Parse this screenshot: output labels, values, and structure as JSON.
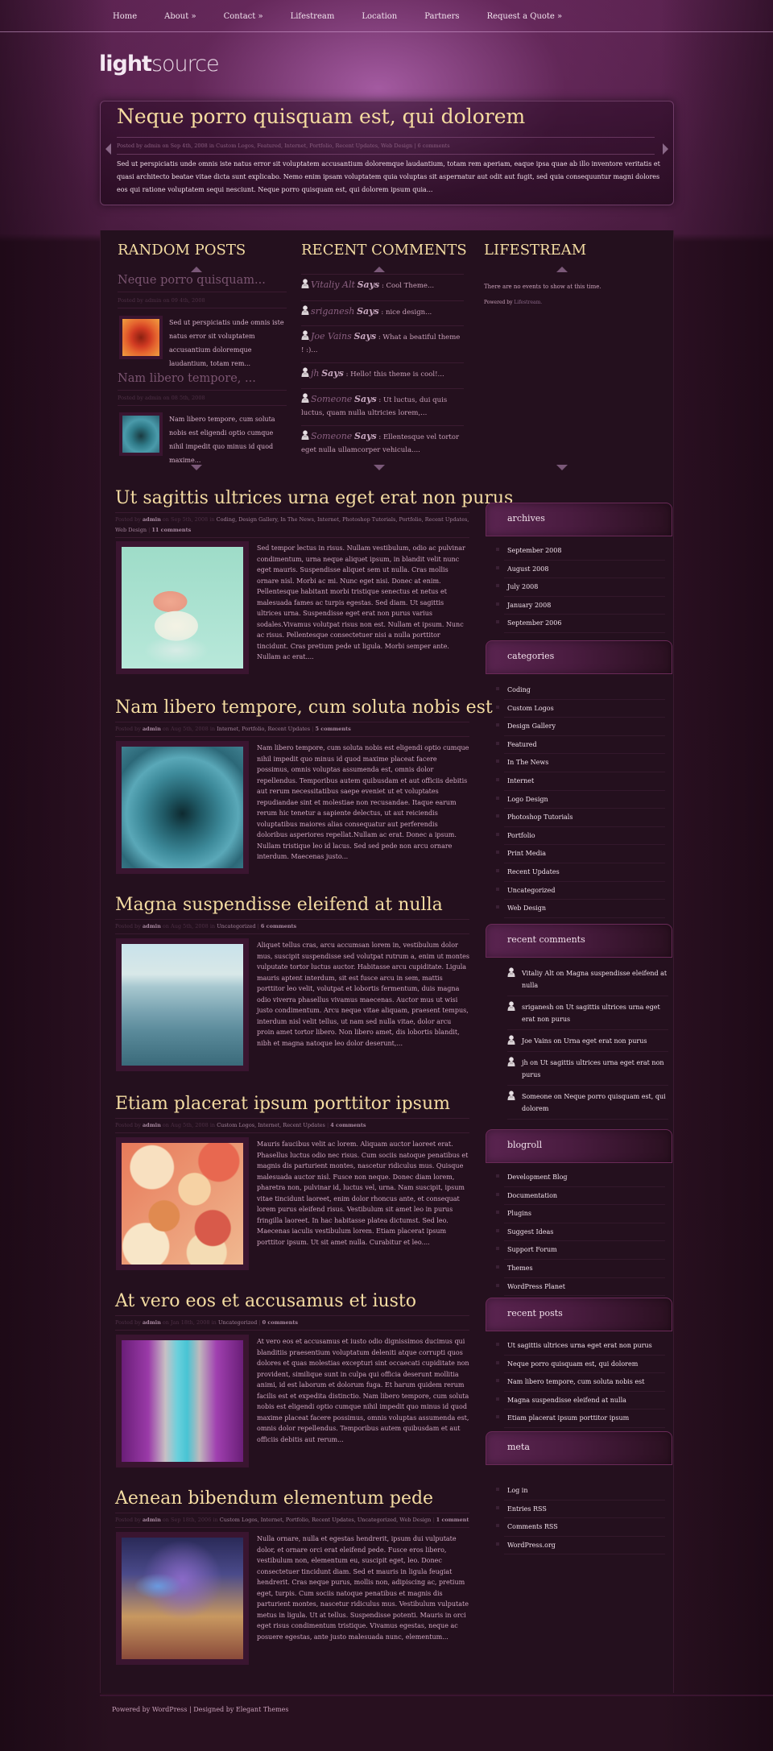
{
  "nav": {
    "items": [
      "Home",
      "About »",
      "Contact »",
      "Lifestream",
      "Location",
      "Partners",
      "Request a Quote »"
    ]
  },
  "logo": {
    "bold": "light",
    "light": "source"
  },
  "featured": {
    "title": "Neque porro quisquam est, qui dolorem",
    "meta": "Posted by admin on Sep 4th, 2008 in Custom Logos, Featured, Internet, Portfolio, Recent Updates, Web Design | 6 comments",
    "excerpt": "Sed ut perspiciatis unde omnis iste natus error sit voluptatem accusantium doloremque laudantium, totam rem aperiam, eaque ipsa quae ab illo inventore veritatis et quasi architecto beatae vitae dicta sunt explicabo. Nemo enim ipsam voluptatem quia voluptas sit aspernatur aut odit aut fugit, sed quia consequuntur magni dolores eos qui ratione voluptatem sequi nesciunt. Neque porro quisquam est, qui dolorem ipsum quia..."
  },
  "random_posts": {
    "title": "RANDOM POSTS",
    "items": [
      {
        "title": "Neque porro quisquam...",
        "meta": "Posted by admin on 09 4th, 2008",
        "excerpt": "Sed ut perspiciatis unde omnis iste natus error sit voluptatem accusantium doloremque laudantium, totam rem...",
        "image": "red-dahlia-flower"
      },
      {
        "title": "Nam libero tempore, ...",
        "meta": "Posted by admin on 08 5th, 2008",
        "excerpt": "Nam libero tempore, cum soluta nobis est eligendi optio cumque nihil impedit quo minus id quod maxime...",
        "image": "blue-succulent"
      }
    ]
  },
  "recent_comments_top": {
    "title": "RECENT COMMENTS",
    "says": "Says",
    "items": [
      {
        "name": "Vitaliy Alt",
        "text": ": Cool Theme..."
      },
      {
        "name": "sriganesh",
        "text": ": nice design..."
      },
      {
        "name": "Joe Vains",
        "text": ": What a beatiful theme ! :)..."
      },
      {
        "name": "jh",
        "text": ": Hello! this theme is cool!..."
      },
      {
        "name": "Someone",
        "text": ": Ut luctus, dui quis luctus, quam nulla ultricies lorem,..."
      },
      {
        "name": "Someone",
        "text": ": Ellentesque vel tortor eget nulla ullamcorper vehicula...."
      }
    ]
  },
  "lifestream": {
    "title": "LIFESTREAM",
    "empty": "There are no events to show at this time.",
    "powered_prefix": "Powered by",
    "powered_link": "Lifestream."
  },
  "posts": [
    {
      "title": "Ut sagittis ultrices urna eget erat non purus",
      "posted_by": "Posted by",
      "author": "admin",
      "date": "on Sep 5th, 2008 in",
      "categories": "Coding, Design Gallery, In The News, Internet, Photoshop Tutorials, Portfolio, Recent Updates, Web Design",
      "comments": "11 comments",
      "image": "teacup-macarons",
      "excerpt": "Sed tempor lectus in risus. Nullam vestibulum, odio ac pulvinar condimentum, urna neque aliquet ipsum, in blandit velit nunc eget mauris. Suspendisse aliquet sem ut nulla. Cras mollis ornare nisl. Morbi ac mi. Nunc eget nisi. Donec at enim. Pellentesque habitant morbi tristique senectus et netus et malesuada fames ac turpis egestas. Sed diam. Ut sagittis ultrices urna. Suspendisse eget erat non purus varius sodales.Vivamus volutpat risus non est. Nullam et ipsum. Nunc ac risus. Pellentesque consectetuer nisi a nulla porttitor tincidunt. Cras pretium pede ut ligula. Morbi semper ante. Nullam ac erat...."
    },
    {
      "title": "Nam libero tempore, cum soluta nobis est",
      "posted_by": "Posted by",
      "author": "admin",
      "date": "on Aug 5th, 2008 in",
      "categories": "Internet, Portfolio, Recent Updates",
      "comments": "5 comments",
      "image": "blue-succulent",
      "excerpt": "Nam libero tempore, cum soluta nobis est eligendi optio cumque nihil impedit quo minus id quod maxime placeat facere possimus, omnis voluptas assumenda est, omnis dolor repellendus. Temporibus autem quibusdam et aut officiis debitis aut rerum necessitatibus saepe eveniet ut et voluptates repudiandae sint et molestiae non recusandae. Itaque earum rerum hic tenetur a sapiente delectus, ut aut reiciendis voluptatibus maiores alias consequatur aut perferendis doloribus asperiores repellat.Nullam ac erat. Donec a ipsum. Nullam tristique leo id lacus. Sed sed pede non arcu ornare interdum. Maecenas justo..."
    },
    {
      "title": "Magna suspendisse eleifend at nulla",
      "posted_by": "Posted by",
      "author": "admin",
      "date": "on Aug 5th, 2008 in",
      "categories": "Uncategorized",
      "comments": "6 comments",
      "image": "misty-mountains",
      "excerpt": "Aliquet tellus cras, arcu accumsan lorem in, vestibulum dolor mus, suscipit suspendisse sed volutpat rutrum a, enim ut montes vulputate tortor luctus auctor. Habitasse arcu cupiditate. Ligula mauris aptent interdum, sit est fusce arcu in sem, mattis porttitor leo velit, volutpat et lobortis fermentum, duis magna odio viverra phasellus vivamus maecenas. Auctor mus ut wisi justo condimentum. Arcu neque vitae aliquam, praesent tempus, interdum nisl velit tellus, ut nam sed nulla vitae, dolor arcu proin amet tortor libero. Non libero amet, dis lobortis blandit, nibh et magna natoque leo dolor deserunt,..."
    },
    {
      "title": "Etiam placerat ipsum porttitor ipsum",
      "posted_by": "Posted by",
      "author": "admin",
      "date": "on Aug 5th, 2008 in",
      "categories": "Custom Logos, Internet, Recent Updates",
      "comments": "4 comments",
      "image": "roses-bouquet",
      "excerpt": "Mauris faucibus velit ac lorem. Aliquam auctor laoreet erat. Phasellus luctus odio nec risus. Cum sociis natoque penatibus et magnis dis parturient montes, nascetur ridiculus mus. Quisque malesuada auctor nisl. Fusce non neque. Donec diam lorem, pharetra non, pulvinar id, luctus vel, urna. Nam suscipit, ipsum vitae tincidunt laoreet, enim dolor rhoncus ante, et consequat lorem purus eleifend risus. Vestibulum sit amet leo in purus fringilla laoreet. In hac habitasse platea dictumst. Sed leo. Maecenas iaculis vestibulum lorem. Etiam placerat ipsum porttitor ipsum. Ut sit amet nulla. Curabitur et leo...."
    },
    {
      "title": "At vero eos et accusamus et iusto",
      "posted_by": "Posted by",
      "author": "admin",
      "date": "on Jan 18th, 2008 in",
      "categories": "Uncategorized",
      "comments": "0 comments",
      "image": "purple-river-canyon",
      "excerpt": "At vero eos et accusamus et iusto odio dignissimos ducimus qui blanditiis praesentium voluptatum deleniti atque corrupti quos dolores et quas molestias excepturi sint occaecati cupiditate non provident, similique sunt in culpa qui officia deserunt mollitia animi, id est laborum et dolorum fuga. Et harum quidem rerum facilis est et expedita distinctio. Nam libero tempore, cum soluta nobis est eligendi optio cumque nihil impedit quo minus id quod maxime placeat facere possimus, omnis voluptas assumenda est, omnis dolor repellendus. Temporibus autem quibusdam et aut officiis debitis aut rerum..."
    },
    {
      "title": "Aenean bibendum elementum pede",
      "posted_by": "Posted by",
      "author": "admin",
      "date": "on Sep 18th, 2006 in",
      "categories": "Custom Logos, Internet, Portfolio, Recent Updates, Uncategorized, Web Design",
      "comments": "1 comment",
      "image": "butterfly-on-lavender",
      "excerpt": "Nulla ornare, nulla et egestas hendrerit, ipsum dui vulputate dolor, et ornare orci erat eleifend pede. Fusce eros libero, vestibulum non, elementum eu, suscipit eget, leo. Donec consectetuer tincidunt diam. Sed et mauris in ligula feugiat hendrerit. Cras neque purus, mollis non, adipiscing ac, pretium eget, turpis. Cum sociis natoque penatibus et magnis dis parturient montes, nascetur ridiculus mus. Vestibulum vulputate metus in ligula. Ut at tellus. Suspendisse potenti. Mauris in orci eget risus condimentum tristique. Vivamus egestas, neque ac posuere egestas, ante justo malesuada nunc, elementum..."
    }
  ],
  "sidebar": {
    "archives": {
      "title": "archives",
      "items": [
        "September 2008",
        "August 2008",
        "July 2008",
        "January 2008",
        "September 2006"
      ]
    },
    "categories": {
      "title": "categories",
      "items": [
        "Coding",
        "Custom Logos",
        "Design Gallery",
        "Featured",
        "In The News",
        "Internet",
        "Logo Design",
        "Photoshop Tutorials",
        "Portfolio",
        "Print Media",
        "Recent Updates",
        "Uncategorized",
        "Web Design"
      ]
    },
    "recent_comments": {
      "title": "recent comments",
      "items": [
        "Vitaliy Alt on Magna suspendisse eleifend at nulla",
        "sriganesh on Ut sagittis ultrices urna eget erat non purus",
        "Joe Vains on Urna eget erat non purus",
        "jh on Ut sagittis ultrices urna eget erat non purus",
        "Someone on Neque porro quisquam est, qui dolorem"
      ]
    },
    "blogroll": {
      "title": "blogroll",
      "items": [
        "Development Blog",
        "Documentation",
        "Plugins",
        "Suggest Ideas",
        "Support Forum",
        "Themes",
        "WordPress Planet"
      ]
    },
    "recent_posts": {
      "title": "recent posts",
      "items": [
        "Ut sagittis ultrices urna eget erat non purus",
        "Neque porro quisquam est, qui dolorem",
        "Nam libero tempore, cum soluta nobis est",
        "Magna suspendisse eleifend at nulla",
        "Etiam placerat ipsum porttitor ipsum"
      ]
    },
    "meta": {
      "title": "meta",
      "items": [
        "Log in",
        "Entries RSS",
        "Comments RSS",
        "WordPress.org"
      ]
    }
  },
  "footer": {
    "text": "Powered by WordPress | Designed by Elegant Themes"
  }
}
